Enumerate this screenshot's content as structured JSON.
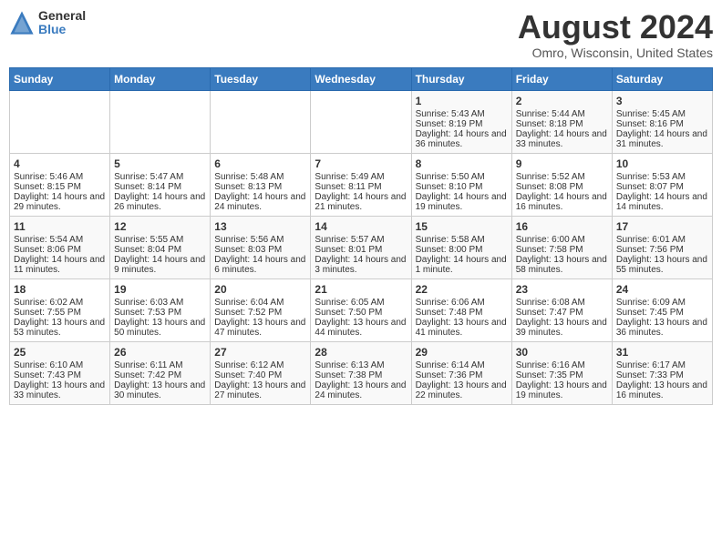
{
  "header": {
    "logo_general": "General",
    "logo_blue": "Blue",
    "month_year": "August 2024",
    "location": "Omro, Wisconsin, United States"
  },
  "weekdays": [
    "Sunday",
    "Monday",
    "Tuesday",
    "Wednesday",
    "Thursday",
    "Friday",
    "Saturday"
  ],
  "weeks": [
    [
      {
        "day": "",
        "text": ""
      },
      {
        "day": "",
        "text": ""
      },
      {
        "day": "",
        "text": ""
      },
      {
        "day": "",
        "text": ""
      },
      {
        "day": "1",
        "text": "Sunrise: 5:43 AM\nSunset: 8:19 PM\nDaylight: 14 hours and 36 minutes."
      },
      {
        "day": "2",
        "text": "Sunrise: 5:44 AM\nSunset: 8:18 PM\nDaylight: 14 hours and 33 minutes."
      },
      {
        "day": "3",
        "text": "Sunrise: 5:45 AM\nSunset: 8:16 PM\nDaylight: 14 hours and 31 minutes."
      }
    ],
    [
      {
        "day": "4",
        "text": "Sunrise: 5:46 AM\nSunset: 8:15 PM\nDaylight: 14 hours and 29 minutes."
      },
      {
        "day": "5",
        "text": "Sunrise: 5:47 AM\nSunset: 8:14 PM\nDaylight: 14 hours and 26 minutes."
      },
      {
        "day": "6",
        "text": "Sunrise: 5:48 AM\nSunset: 8:13 PM\nDaylight: 14 hours and 24 minutes."
      },
      {
        "day": "7",
        "text": "Sunrise: 5:49 AM\nSunset: 8:11 PM\nDaylight: 14 hours and 21 minutes."
      },
      {
        "day": "8",
        "text": "Sunrise: 5:50 AM\nSunset: 8:10 PM\nDaylight: 14 hours and 19 minutes."
      },
      {
        "day": "9",
        "text": "Sunrise: 5:52 AM\nSunset: 8:08 PM\nDaylight: 14 hours and 16 minutes."
      },
      {
        "day": "10",
        "text": "Sunrise: 5:53 AM\nSunset: 8:07 PM\nDaylight: 14 hours and 14 minutes."
      }
    ],
    [
      {
        "day": "11",
        "text": "Sunrise: 5:54 AM\nSunset: 8:06 PM\nDaylight: 14 hours and 11 minutes."
      },
      {
        "day": "12",
        "text": "Sunrise: 5:55 AM\nSunset: 8:04 PM\nDaylight: 14 hours and 9 minutes."
      },
      {
        "day": "13",
        "text": "Sunrise: 5:56 AM\nSunset: 8:03 PM\nDaylight: 14 hours and 6 minutes."
      },
      {
        "day": "14",
        "text": "Sunrise: 5:57 AM\nSunset: 8:01 PM\nDaylight: 14 hours and 3 minutes."
      },
      {
        "day": "15",
        "text": "Sunrise: 5:58 AM\nSunset: 8:00 PM\nDaylight: 14 hours and 1 minute."
      },
      {
        "day": "16",
        "text": "Sunrise: 6:00 AM\nSunset: 7:58 PM\nDaylight: 13 hours and 58 minutes."
      },
      {
        "day": "17",
        "text": "Sunrise: 6:01 AM\nSunset: 7:56 PM\nDaylight: 13 hours and 55 minutes."
      }
    ],
    [
      {
        "day": "18",
        "text": "Sunrise: 6:02 AM\nSunset: 7:55 PM\nDaylight: 13 hours and 53 minutes."
      },
      {
        "day": "19",
        "text": "Sunrise: 6:03 AM\nSunset: 7:53 PM\nDaylight: 13 hours and 50 minutes."
      },
      {
        "day": "20",
        "text": "Sunrise: 6:04 AM\nSunset: 7:52 PM\nDaylight: 13 hours and 47 minutes."
      },
      {
        "day": "21",
        "text": "Sunrise: 6:05 AM\nSunset: 7:50 PM\nDaylight: 13 hours and 44 minutes."
      },
      {
        "day": "22",
        "text": "Sunrise: 6:06 AM\nSunset: 7:48 PM\nDaylight: 13 hours and 41 minutes."
      },
      {
        "day": "23",
        "text": "Sunrise: 6:08 AM\nSunset: 7:47 PM\nDaylight: 13 hours and 39 minutes."
      },
      {
        "day": "24",
        "text": "Sunrise: 6:09 AM\nSunset: 7:45 PM\nDaylight: 13 hours and 36 minutes."
      }
    ],
    [
      {
        "day": "25",
        "text": "Sunrise: 6:10 AM\nSunset: 7:43 PM\nDaylight: 13 hours and 33 minutes."
      },
      {
        "day": "26",
        "text": "Sunrise: 6:11 AM\nSunset: 7:42 PM\nDaylight: 13 hours and 30 minutes."
      },
      {
        "day": "27",
        "text": "Sunrise: 6:12 AM\nSunset: 7:40 PM\nDaylight: 13 hours and 27 minutes."
      },
      {
        "day": "28",
        "text": "Sunrise: 6:13 AM\nSunset: 7:38 PM\nDaylight: 13 hours and 24 minutes."
      },
      {
        "day": "29",
        "text": "Sunrise: 6:14 AM\nSunset: 7:36 PM\nDaylight: 13 hours and 22 minutes."
      },
      {
        "day": "30",
        "text": "Sunrise: 6:16 AM\nSunset: 7:35 PM\nDaylight: 13 hours and 19 minutes."
      },
      {
        "day": "31",
        "text": "Sunrise: 6:17 AM\nSunset: 7:33 PM\nDaylight: 13 hours and 16 minutes."
      }
    ]
  ]
}
